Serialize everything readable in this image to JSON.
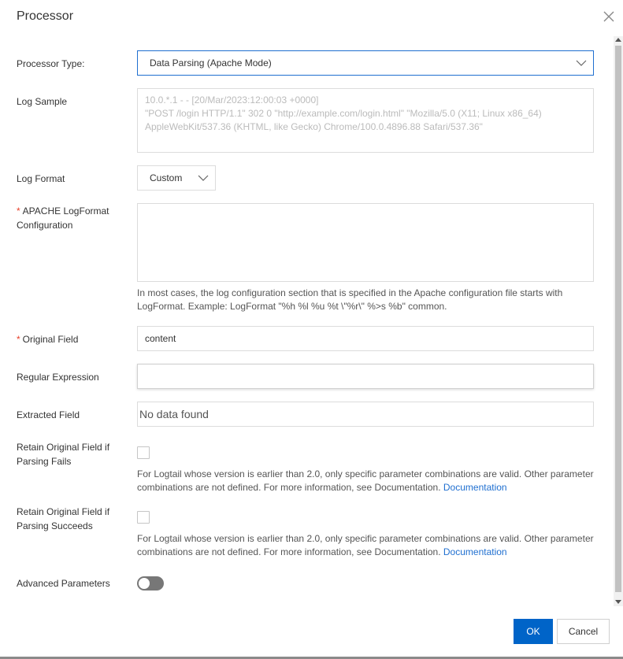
{
  "dialog": {
    "title": "Processor",
    "ok_label": "OK",
    "cancel_label": "Cancel"
  },
  "form": {
    "processor_type": {
      "label": "Processor Type:",
      "value": "Data Parsing (Apache Mode)"
    },
    "log_sample": {
      "label": "Log Sample",
      "placeholder_lines": [
        "10.0.*.1 - - [20/Mar/2023:12:00:03 +0000]",
        "\"POST /login HTTP/1.1\" 302 0 \"http://example.com/login.html\" \"Mozilla/5.0 (X11; Linux x86_64)",
        "AppleWebKit/537.36 (KHTML, like Gecko) Chrome/100.0.4896.88 Safari/537.36\""
      ]
    },
    "log_format": {
      "label": "Log Format",
      "value": "Custom"
    },
    "apache_logformat": {
      "label_line1": "APACHE LogFormat",
      "label_line2": "Configuration",
      "required_mark": "*",
      "value": "",
      "help_line1": "In most cases, the log configuration section that is specified in the Apache configuration file starts with",
      "help_line2": "LogFormat. Example: LogFormat \"%h %l %u %t \\\"%r\\\" %>s %b\" common."
    },
    "original_field": {
      "label": "Original Field",
      "required_mark": "*",
      "value": "content"
    },
    "regular_expression": {
      "label": "Regular Expression",
      "value": ""
    },
    "extracted_field": {
      "label": "Extracted Field",
      "value": "No data found"
    },
    "retain_on_fail": {
      "label_line1": "Retain Original Field if",
      "label_line2": "Parsing Fails",
      "checked": false,
      "help_line1": "For Logtail whose version is earlier than 2.0, only specific parameter combinations are valid. Other parameter",
      "help_line2": "combinations are not defined. For more information, see Documentation.",
      "link": "Documentation"
    },
    "retain_on_success": {
      "label_line1": "Retain Original Field if",
      "label_line2": "Parsing Succeeds",
      "checked": false,
      "help_line1": "For Logtail whose version is earlier than 2.0, only specific parameter combinations are valid. Other parameter",
      "help_line2": "combinations are not defined. For more information, see Documentation.",
      "link": "Documentation"
    },
    "advanced_parameters": {
      "label": "Advanced Parameters",
      "enabled": false
    }
  },
  "icons": {
    "close": "close-icon",
    "chevron": "chevron-down-icon"
  },
  "colors": {
    "primary": "#0064c8",
    "link": "#1f6fd0",
    "required": "#e8412b"
  }
}
